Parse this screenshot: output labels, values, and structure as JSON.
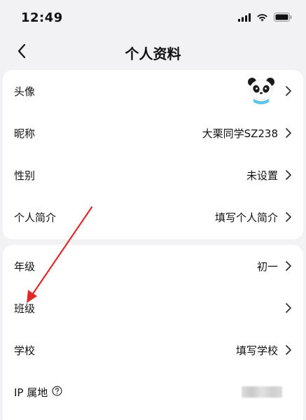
{
  "status_bar": {
    "time": "12:49"
  },
  "nav": {
    "title": "个人资料"
  },
  "profile": {
    "rows": [
      {
        "label": "头像",
        "value": ""
      },
      {
        "label": "昵称",
        "value": "大栗同学SZ238"
      },
      {
        "label": "性别",
        "value": "未设置"
      },
      {
        "label": "个人简介",
        "value": "填写个人简介"
      }
    ]
  },
  "school": {
    "rows": [
      {
        "label": "年级",
        "value": "初一"
      },
      {
        "label": "班级",
        "value": ""
      },
      {
        "label": "学校",
        "value": "填写学校"
      },
      {
        "label": "IP 属地",
        "value": ""
      }
    ]
  },
  "icons": {
    "back": "chevron-left-icon",
    "chevron": "chevron-right-icon",
    "help": "question-circle-icon",
    "signal": "signal-icon",
    "wifi": "wifi-icon",
    "battery": "battery-icon",
    "avatar": "panda-avatar"
  },
  "colors": {
    "background": "#f2f2f4",
    "card": "#ffffff",
    "annotation_arrow": "#e02a2a"
  }
}
